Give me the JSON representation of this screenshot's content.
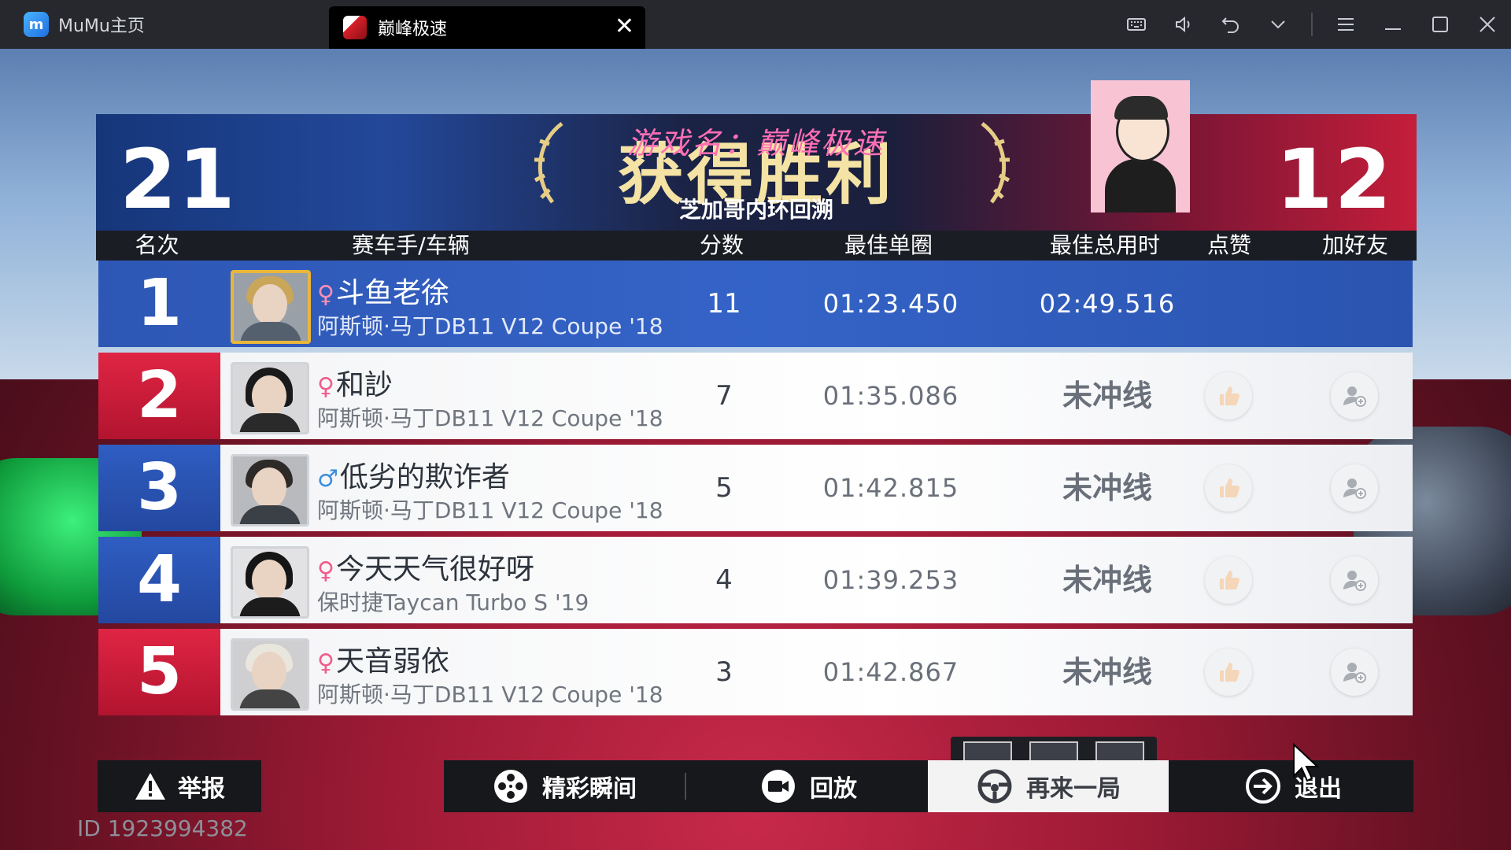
{
  "titlebar": {
    "home_tab_label": "MuMu主页",
    "game_tab_label": "巅峰极速",
    "close_glyph": "✕",
    "controls": [
      "keyboard-icon",
      "volume-icon",
      "undo-icon",
      "chevron-down-icon",
      "menu-icon",
      "minimize-icon",
      "maximize-icon",
      "close-icon"
    ]
  },
  "banner": {
    "score_left": "21",
    "score_right": "12",
    "title": "获得胜利",
    "overlay_caption": "游戏名：巅峰极速",
    "track": "芝加哥内环回溯"
  },
  "table": {
    "headers": {
      "rank": "名次",
      "driver": "赛车手/车辆",
      "score": "分数",
      "best_lap": "最佳单圈",
      "best_total": "最佳总用时",
      "like": "点赞",
      "add_friend": "加好友"
    },
    "rows": [
      {
        "rank": "1",
        "gender": "♀",
        "name": "斗鱼老徐",
        "car": "阿斯顿·马丁DB11 V12 Coupe '18",
        "score": "11",
        "best_lap": "01:23.450",
        "best_total": "02:49.516"
      },
      {
        "rank": "2",
        "gender": "♀",
        "name": "和訬",
        "car": "阿斯顿·马丁DB11 V12 Coupe '18",
        "score": "7",
        "best_lap": "01:35.086",
        "best_total": "未冲线"
      },
      {
        "rank": "3",
        "gender": "♂",
        "name": "低劣的欺诈者",
        "car": "阿斯顿·马丁DB11 V12 Coupe '18",
        "score": "5",
        "best_lap": "01:42.815",
        "best_total": "未冲线"
      },
      {
        "rank": "4",
        "gender": "♀",
        "name": "今天天气很好呀",
        "car": "保时捷Taycan Turbo S  '19",
        "score": "4",
        "best_lap": "01:39.253",
        "best_total": "未冲线"
      },
      {
        "rank": "5",
        "gender": "♀",
        "name": "天音弱依",
        "car": "阿斯顿·马丁DB11 V12 Coupe '18",
        "score": "3",
        "best_lap": "01:42.867",
        "best_total": "未冲线"
      }
    ]
  },
  "bottom": {
    "report": "举报",
    "highlights": "精彩瞬间",
    "replay": "回放",
    "play_again": "再来一局",
    "exit": "退出",
    "id_text": "ID 1923994382"
  },
  "colors": {
    "blue_accent": "#2f5dc2",
    "red_accent": "#e02544",
    "gold_title": "#f4e3a4",
    "overlay_pink": "#ff6fb5"
  }
}
